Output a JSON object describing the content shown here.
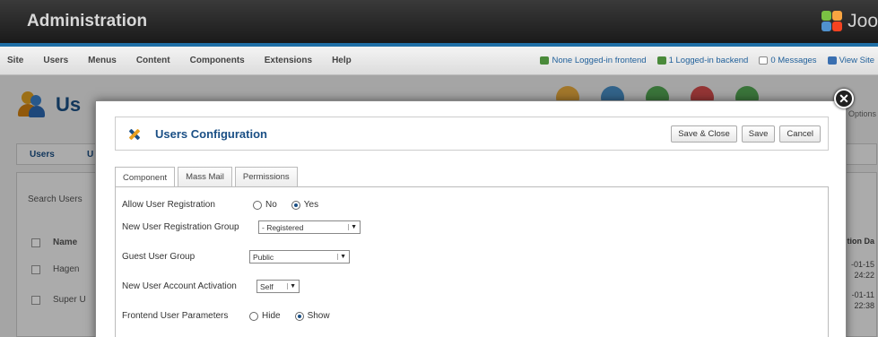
{
  "header": {
    "title": "Administration",
    "logo_text": "Joo"
  },
  "menubar": {
    "items": [
      "Site",
      "Users",
      "Menus",
      "Content",
      "Components",
      "Extensions",
      "Help"
    ],
    "status": [
      {
        "label": "None Logged-in frontend",
        "icon": "users-icon"
      },
      {
        "label": "1 Logged-in backend",
        "icon": "users-icon"
      },
      {
        "label": "0 Messages",
        "icon": "mail-icon"
      },
      {
        "label": "View Site",
        "icon": "monitor-icon"
      }
    ]
  },
  "background_page": {
    "title": "Us",
    "options_label": "Options",
    "tab_users": "Users",
    "tab_u": "U",
    "search_label": "Search Users",
    "column_name": "Name",
    "column_date": "tion Da",
    "rows": [
      {
        "name": "Hagen",
        "date1": "-01-15",
        "date2": "24:22"
      },
      {
        "name": "Super U",
        "date1": "-01-11",
        "date2": "22:38"
      }
    ]
  },
  "modal": {
    "title": "Users Configuration",
    "buttons": {
      "save_close": "Save & Close",
      "save": "Save",
      "cancel": "Cancel"
    },
    "tabs": [
      "Component",
      "Mass Mail",
      "Permissions"
    ],
    "fields": {
      "allow_registration": {
        "label": "Allow User Registration",
        "options": [
          "No",
          "Yes"
        ],
        "selected": "Yes"
      },
      "new_user_group": {
        "label": "New User Registration Group",
        "value": "- Registered"
      },
      "guest_group": {
        "label": "Guest User Group",
        "value": "Public"
      },
      "account_activation": {
        "label": "New User Account Activation",
        "value": "Self"
      },
      "frontend_params": {
        "label": "Frontend User Parameters",
        "options": [
          "Hide",
          "Show"
        ],
        "selected": "Show"
      }
    }
  },
  "close_icon": "close-icon",
  "colors": {
    "accent_blue": "#1f6fa6",
    "title_blue": "#1a4f85",
    "header_dark": "#1a1a1a"
  }
}
